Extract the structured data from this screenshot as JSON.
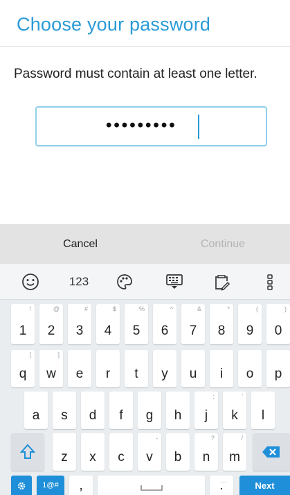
{
  "header": {
    "title": "Choose your password"
  },
  "message": "Password must contain at least one letter.",
  "password_field": {
    "masked_value": "•••••••••"
  },
  "actions": {
    "cancel_label": "Cancel",
    "continue_label": "Continue"
  },
  "keyboard": {
    "toolbar": {
      "numbers_label": "123"
    },
    "row1": [
      {
        "key": "1",
        "hint": "!"
      },
      {
        "key": "2",
        "hint": "@"
      },
      {
        "key": "3",
        "hint": "#"
      },
      {
        "key": "4",
        "hint": "$"
      },
      {
        "key": "5",
        "hint": "%"
      },
      {
        "key": "6",
        "hint": "^"
      },
      {
        "key": "7",
        "hint": "&"
      },
      {
        "key": "8",
        "hint": "*"
      },
      {
        "key": "9",
        "hint": "("
      },
      {
        "key": "0",
        "hint": ")"
      }
    ],
    "row2": [
      {
        "key": "q",
        "hint": "["
      },
      {
        "key": "w",
        "hint": "]"
      },
      {
        "key": "e",
        "hint": ""
      },
      {
        "key": "r",
        "hint": ""
      },
      {
        "key": "t",
        "hint": ""
      },
      {
        "key": "y",
        "hint": ""
      },
      {
        "key": "u",
        "hint": ""
      },
      {
        "key": "i",
        "hint": ""
      },
      {
        "key": "o",
        "hint": ""
      },
      {
        "key": "p",
        "hint": ""
      }
    ],
    "row3": [
      {
        "key": "a",
        "hint": ""
      },
      {
        "key": "s",
        "hint": ""
      },
      {
        "key": "d",
        "hint": ""
      },
      {
        "key": "f",
        "hint": ""
      },
      {
        "key": "g",
        "hint": ""
      },
      {
        "key": "h",
        "hint": ""
      },
      {
        "key": "j",
        "hint": ";"
      },
      {
        "key": "k",
        "hint": "'"
      },
      {
        "key": "l",
        "hint": ""
      }
    ],
    "row4": [
      {
        "key": "z",
        "hint": ""
      },
      {
        "key": "x",
        "hint": ""
      },
      {
        "key": "c",
        "hint": ""
      },
      {
        "key": "v",
        "hint": "-"
      },
      {
        "key": "b",
        "hint": ""
      },
      {
        "key": "n",
        "hint": "?"
      },
      {
        "key": "m",
        "hint": "/"
      }
    ],
    "bottom": {
      "symbols_label": "1@#",
      "comma_label": ",",
      "period_label": ".",
      "period_hint": "...",
      "next_label": "Next"
    },
    "colors": {
      "accent": "#1e8fd8",
      "title_blue": "#2a9bd6"
    }
  }
}
